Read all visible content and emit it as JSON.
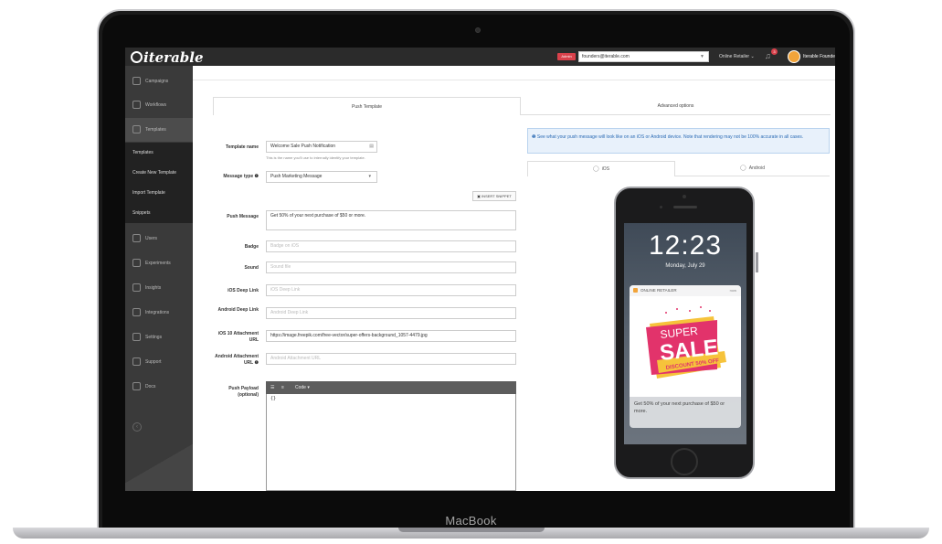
{
  "device_label": "MacBook",
  "topbar": {
    "logo_text": "iterable",
    "admin_badge": "Admin",
    "email_value": "founders@iterable.com",
    "org_select": "Online Retailer",
    "notification_count": "3",
    "user_name": "Iterable Founde"
  },
  "sidebar": {
    "items": [
      {
        "label": "Campaigns"
      },
      {
        "label": "Workflows"
      },
      {
        "label": "Templates"
      }
    ],
    "sub_items": [
      {
        "label": "Templates"
      },
      {
        "label": "Create New Template"
      },
      {
        "label": "Import Template"
      },
      {
        "label": "Snippets"
      }
    ],
    "items_after": [
      {
        "label": "Users"
      },
      {
        "label": "Experiments"
      },
      {
        "label": "Insights"
      },
      {
        "label": "Integrations"
      },
      {
        "label": "Settings"
      },
      {
        "label": "Support"
      },
      {
        "label": "Docs"
      }
    ]
  },
  "tabs": {
    "push_template": "Push Template",
    "advanced_options": "Advanced options"
  },
  "form": {
    "template_name_label": "Template name",
    "template_name_value": "Welcome Sale Push Notification",
    "template_name_hint": "This is the name you'll use to internally identify your template.",
    "message_type_label": "Message type ❶",
    "message_type_value": "Push Marketing Message",
    "insert_snippet": "INSERT SNIPPET",
    "push_message_label": "Push Message",
    "push_message_value": "Get 50% of your next purchase of $50 or more.",
    "badge_label": "Badge",
    "badge_placeholder": "Badge on iOS",
    "sound_label": "Sound",
    "sound_placeholder": "Sound file",
    "ios_deep_link_label": "iOS Deep Link",
    "ios_deep_link_placeholder": "iOS Deep Link",
    "android_deep_link_label": "Android Deep Link",
    "android_deep_link_placeholder": "Android Deep Link",
    "ios10_label": "iOS 10 Attachment URL",
    "ios10_value": "https://image.freepik.com/free-vector/super-offers-background_1057-4479.jpg",
    "android_attach_label": "Android Attachment URL ❶",
    "android_attach_placeholder": "Android Attachment URL",
    "push_payload_label": "Push Payload (optional)",
    "editor_code": "Code ▾",
    "editor_content": "{}"
  },
  "preview": {
    "info_text": "❶ See what your push message will look like on an iOS or Android device. Note that rendering may not be 100% accurate in all cases.",
    "tab_ios": "iOS",
    "tab_android": "Android",
    "clock": "12:23",
    "date": "Monday, July 29",
    "app_name": "ONLINE RETAILER",
    "notif_time": "now",
    "sale_super": "SUPER",
    "sale_main": "SALE",
    "sale_discount": "DISCOUNT 50% OFF",
    "notif_body": "Get 50% of your next purchase of $50 or more."
  },
  "colors": {
    "sidebar_bg": "#3a3a3a",
    "topbar_bg": "#2b2b2b",
    "admin_red": "#d9414b",
    "info_blue": "#2a6ab4",
    "sale_pink": "#e2336b",
    "sale_yellow": "#f6c33b"
  }
}
